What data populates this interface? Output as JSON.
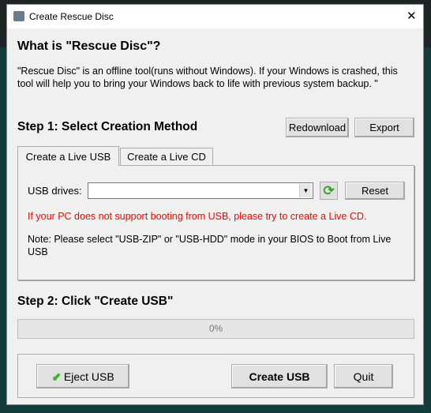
{
  "window": {
    "title": "Create Rescue Disc",
    "close": "✕"
  },
  "intro": {
    "heading": "What is \"Rescue Disc\"?",
    "text": "\"Rescue Disc\" is an offline tool(runs without Windows). If your Windows is crashed, this tool will help you to bring your Windows back to life with previous system backup. \""
  },
  "step1": {
    "title": "Step 1:  Select Creation Method",
    "redownload": "Redownload",
    "export": "Export",
    "tabs": [
      {
        "label": "Create a Live USB",
        "active": true
      },
      {
        "label": "Create a Live CD",
        "active": false
      }
    ],
    "usb_label": "USB drives:",
    "usb_value": "",
    "reset": "Reset",
    "warning": "If your PC does not support booting from USB, please try to create a Live CD.",
    "note": "Note: Please select \"USB-ZIP\" or \"USB-HDD\" mode in your BIOS to Boot from Live USB",
    "warning_color": "#ff0000"
  },
  "step2": {
    "title": "Step 2:  Click \"Create USB\"",
    "progress_text": "0%",
    "progress": 0
  },
  "footer": {
    "eject": "Eject USB",
    "create": "Create USB",
    "quit": "Quit"
  }
}
